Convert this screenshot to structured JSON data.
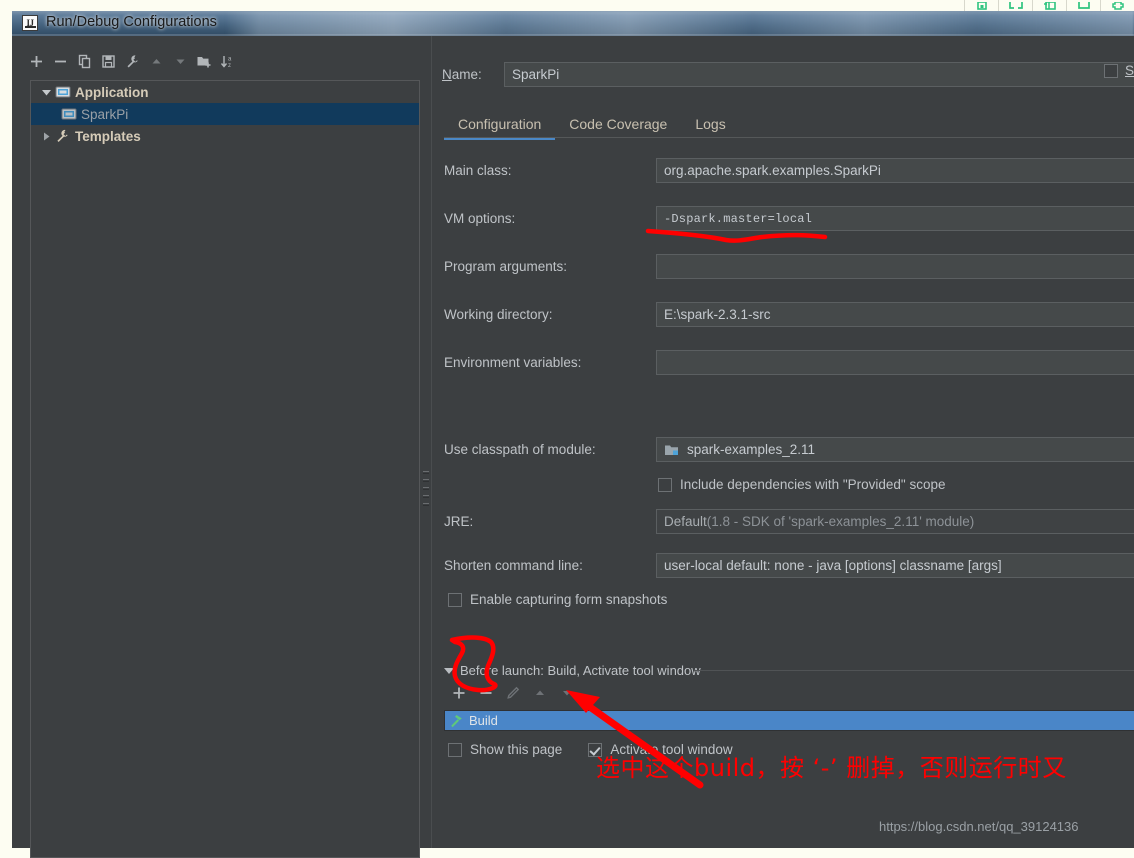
{
  "window": {
    "title": "Run/Debug Configurations",
    "icon": "intellij-idea-icon"
  },
  "left_toolbar": [
    {
      "name": "add-configuration-button",
      "icon": "plus-icon",
      "label": "+"
    },
    {
      "name": "remove-configuration-button",
      "icon": "minus-icon",
      "label": "−"
    },
    {
      "name": "copy-configuration-button",
      "icon": "copy-icon",
      "label": "Copy"
    },
    {
      "name": "save-configuration-button",
      "icon": "save-icon",
      "label": "Save"
    },
    {
      "name": "edit-defaults-button",
      "icon": "wrench-icon",
      "label": "Edit defaults"
    },
    {
      "name": "move-up-button",
      "icon": "arrow-up-icon",
      "label": "Move up"
    },
    {
      "name": "move-down-button",
      "icon": "arrow-down-icon",
      "label": "Move down"
    },
    {
      "name": "new-folder-button",
      "icon": "folder-add-icon",
      "label": "New folder"
    },
    {
      "name": "sort-alphabetically-button",
      "icon": "sort-az-icon",
      "label": "Sort"
    }
  ],
  "tree": {
    "nodes": [
      {
        "label": "Application",
        "icon": "application-icon",
        "expanded": true,
        "selected": false,
        "child": false
      },
      {
        "label": "SparkPi",
        "icon": "application-icon",
        "expanded": false,
        "selected": true,
        "child": true
      },
      {
        "label": "Templates",
        "icon": "wrench-icon",
        "expanded": false,
        "selected": false,
        "child": false
      }
    ]
  },
  "form": {
    "name_label": "Name:",
    "name_label_mnemonic": "N",
    "name_value": "SparkPi",
    "share_label": "Sh",
    "share_label_mnemonic": "S",
    "share_checked": false,
    "tabs": [
      {
        "label": "Configuration",
        "active": true
      },
      {
        "label": "Code Coverage",
        "active": false
      },
      {
        "label": "Logs",
        "active": false
      }
    ],
    "fields": [
      {
        "label_pre": "Main ",
        "label_mn": "c",
        "label_post": "lass:",
        "value": "org.apache.spark.examples.SparkPi",
        "mono": false,
        "disabled": false
      },
      {
        "label_pre": "V",
        "label_mn": "M",
        "label_post": " options:",
        "value": "-Dspark.master=local",
        "mono": true,
        "disabled": false
      },
      {
        "label_pre": "Program a",
        "label_mn": "r",
        "label_post": "guments:",
        "value": "",
        "mono": false,
        "disabled": false
      },
      {
        "label_pre": "",
        "label_mn": "W",
        "label_post": "orking directory:",
        "value": "E:\\spark-2.3.1-src",
        "mono": false,
        "disabled": false
      },
      {
        "label_pre": "",
        "label_mn": "E",
        "label_post": "nvironment variables:",
        "value": "",
        "mono": false,
        "disabled": false
      }
    ],
    "classpath_label_pre": "Use classpath of m",
    "classpath_label_mn": "o",
    "classpath_label_post": "dule:",
    "classpath_value": "spark-examples_2.11",
    "classpath_icon": "module-icon",
    "include_deps_label": "Include dependencies with \"Provided\" scope",
    "include_deps_checked": false,
    "jre_label_pre": "",
    "jre_label_mn": "J",
    "jre_label_post": "RE:",
    "jre_value_main": "Default",
    "jre_value_dim": " (1.8 - SDK of 'spark-examples_2.11' module)",
    "shorten_label_pre": "Shorten command ",
    "shorten_label_mn": "l",
    "shorten_label_post": "ine:",
    "shorten_value": "user-local default: none - java [options] classname [args]",
    "snapshots_label_pre": "",
    "snapshots_label_mn": "E",
    "snapshots_label_post": "nable capturing form snapshots",
    "snapshots_checked": false
  },
  "before_launch": {
    "header_mn": "B",
    "header_pre": "",
    "header_post": "efore launch: Build, Activate tool window",
    "toolbar": [
      {
        "name": "add-task-button",
        "icon": "plus-icon",
        "label": "+"
      },
      {
        "name": "remove-task-button",
        "icon": "minus-icon",
        "label": "−"
      },
      {
        "name": "edit-task-button",
        "icon": "pencil-icon",
        "label": "Edit"
      },
      {
        "name": "task-move-up-button",
        "icon": "arrow-up-icon",
        "label": "Move up"
      },
      {
        "name": "task-move-down-button",
        "icon": "arrow-down-icon",
        "label": "Move down"
      }
    ],
    "task_label": "Build",
    "task_icon": "hammer-icon",
    "task_selected": true,
    "show_page_label": "Show this page",
    "show_page_checked": false,
    "activate_tool_window_label": "Activate tool window",
    "activate_tool_window_checked": true
  },
  "annotations": {
    "chinese_note": "选中这个build，按 ‘-’ 删掉，否则运行时又",
    "watermark": "https://blog.csdn.net/qq_39124136",
    "accent_red": "#ff0000"
  },
  "colors": {
    "dialog_bg": "#3c3f41",
    "field_bg": "#45494a",
    "tab_accent": "#4a88c7",
    "tree_selection": "#113a5c",
    "task_selection": "#4a86c8",
    "label_text": "#bfc3c7"
  }
}
